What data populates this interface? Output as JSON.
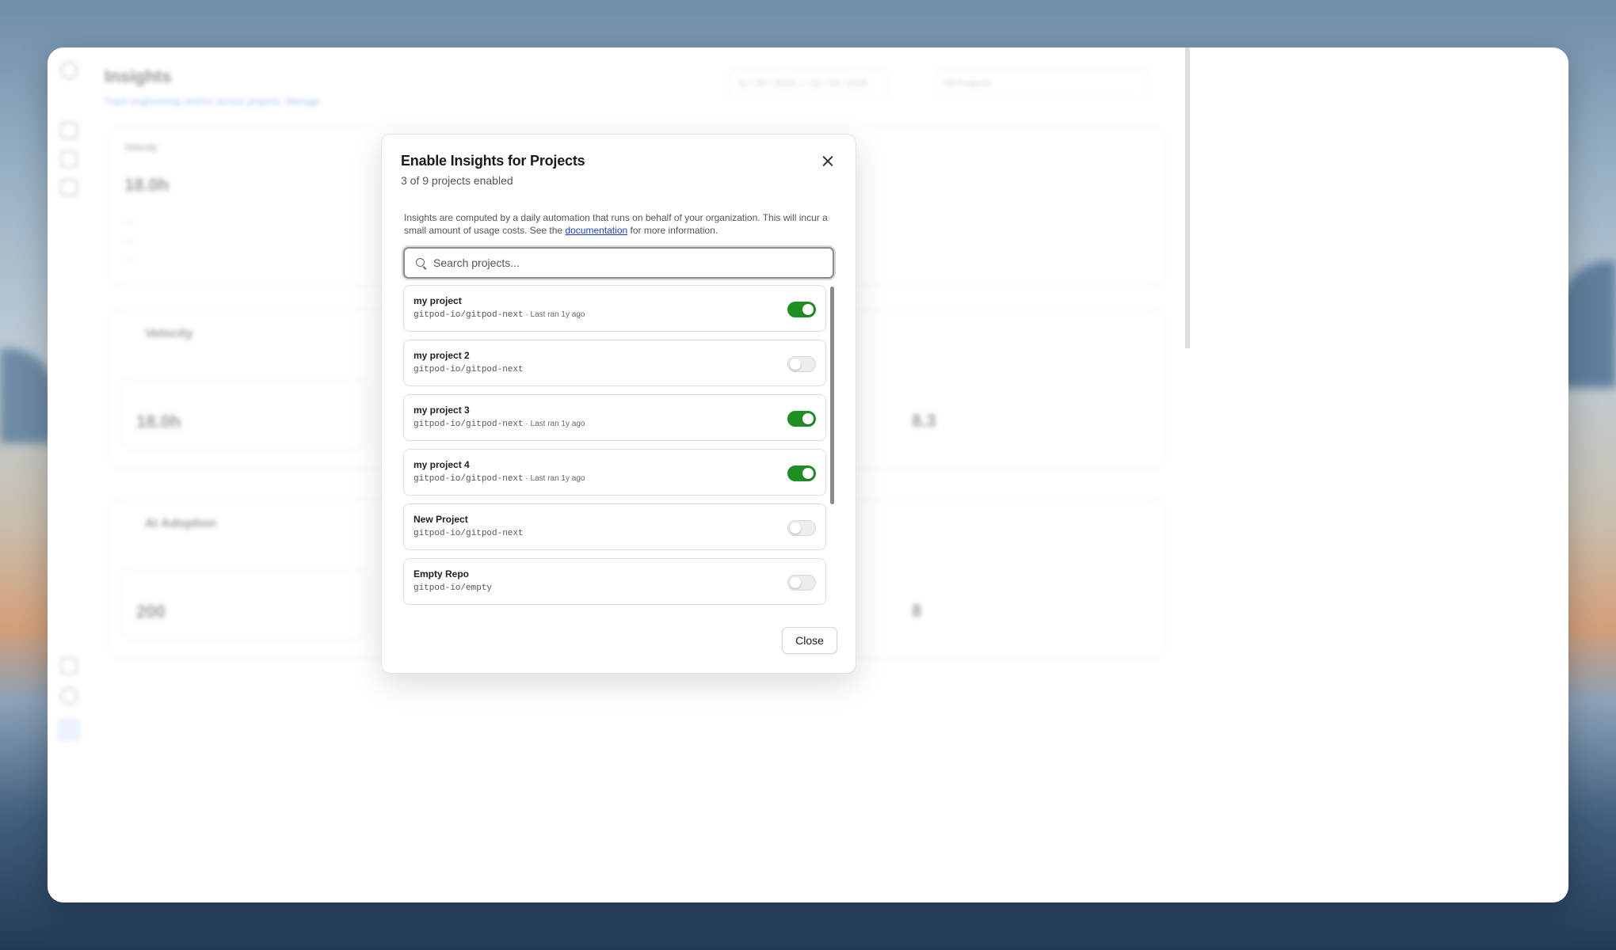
{
  "background_app": {
    "title": "Insights",
    "subtitle": "Track engineering metrics across projects.",
    "subtitle_link": "Manage",
    "date_range": "11 / 24 / 2025 — 12 / 24 / 2025",
    "project_filter": "All Projects",
    "velocity_label": "Velocity",
    "metric_value": "18.0h",
    "metric_value_2": "8.3",
    "adoption_label": "AI Adoption",
    "adoption_value": "200",
    "adoption_value_2": "8"
  },
  "modal": {
    "title": "Enable Insights for Projects",
    "subtitle": "3 of 9 projects enabled",
    "info_before": "Insights are computed by a daily automation that runs on behalf of your organization. This will incur a small amount of usage costs. See the ",
    "info_link": "documentation",
    "info_after": " for more information.",
    "search_placeholder": "Search projects...",
    "close_label": "Close",
    "projects": [
      {
        "name": "my project",
        "repo": "gitpod-io/gitpod-next",
        "last_ran": " · Last ran 1y ago",
        "enabled": true
      },
      {
        "name": "my project 2",
        "repo": "gitpod-io/gitpod-next",
        "last_ran": "",
        "enabled": false
      },
      {
        "name": "my project 3",
        "repo": "gitpod-io/gitpod-next",
        "last_ran": " · Last ran 1y ago",
        "enabled": true
      },
      {
        "name": "my project 4",
        "repo": "gitpod-io/gitpod-next",
        "last_ran": " · Last ran 1y ago",
        "enabled": true
      },
      {
        "name": "New Project",
        "repo": "gitpod-io/gitpod-next",
        "last_ran": "",
        "enabled": false
      },
      {
        "name": "Empty Repo",
        "repo": "gitpod-io/empty",
        "last_ran": "",
        "enabled": false
      }
    ]
  },
  "colors": {
    "toggle_on": "#1f8f24",
    "link": "#1b3fc4"
  }
}
